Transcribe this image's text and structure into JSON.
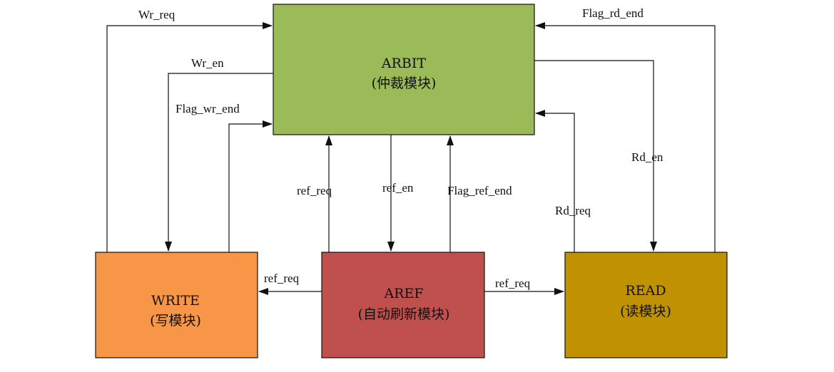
{
  "colors": {
    "arbit": "#9bbb59",
    "write": "#f79646",
    "aref": "#c0504d",
    "read": "#c09100",
    "line": "#111111"
  },
  "modules": {
    "arbit": {
      "name": "ARBIT",
      "subtitle": "(仲裁模块)"
    },
    "write": {
      "name": "WRITE",
      "subtitle": "(写模块)"
    },
    "aref": {
      "name": "AREF",
      "subtitle": "(自动刷新模块)"
    },
    "read": {
      "name": "READ",
      "subtitle": "(读模块)"
    }
  },
  "signals": {
    "wr_req": "Wr_req",
    "wr_en": "Wr_en",
    "flag_wr_end": "Flag_wr_end",
    "ref_req_up": "ref_req",
    "ref_en": "ref_en",
    "flag_ref_end": "Flag_ref_end",
    "flag_rd_end": "Flag_rd_end",
    "rd_en": "Rd_en",
    "rd_req": "Rd_req",
    "ref_req_to_write": "ref_req",
    "ref_req_to_read": "ref_req"
  }
}
